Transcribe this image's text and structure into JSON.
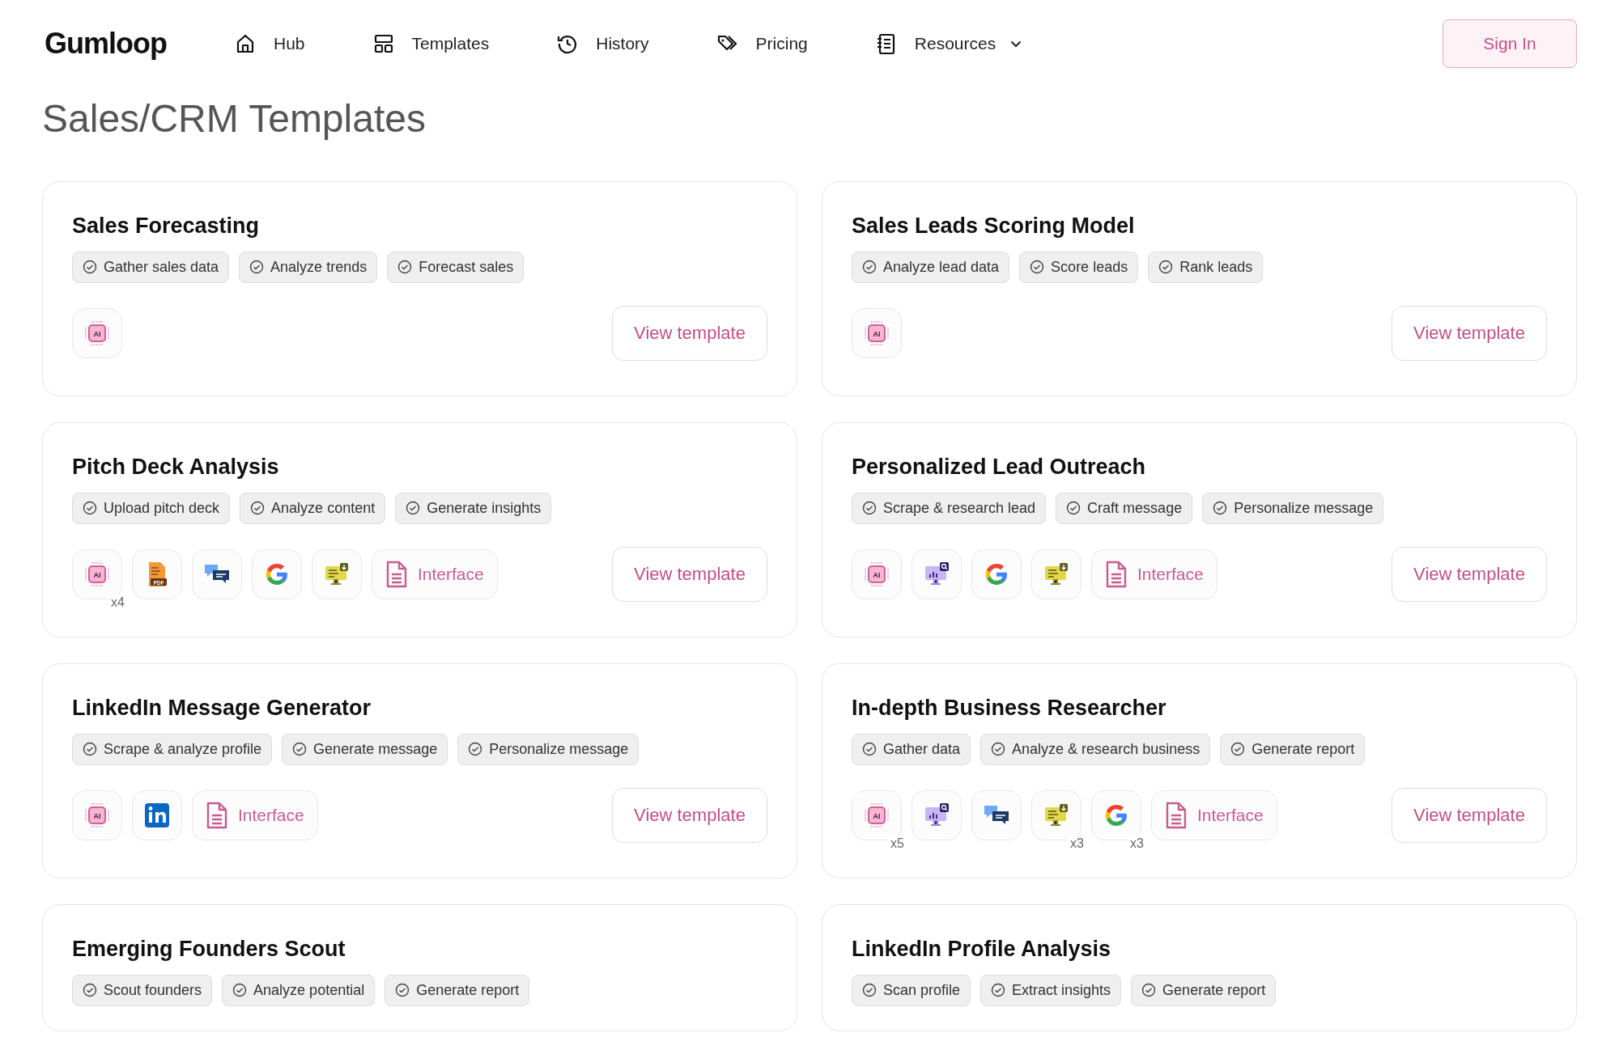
{
  "nav": {
    "logo": "Gumloop",
    "items": [
      {
        "label": "Hub",
        "dropdown": false
      },
      {
        "label": "Templates",
        "dropdown": false
      },
      {
        "label": "History",
        "dropdown": false
      },
      {
        "label": "Pricing",
        "dropdown": false
      },
      {
        "label": "Resources",
        "dropdown": true
      }
    ],
    "sign_in": "Sign In"
  },
  "page_title": "Sales/CRM Templates",
  "cards": [
    {
      "title": "Sales Forecasting",
      "steps": [
        "Gather sales data",
        "Analyze trends",
        "Forecast sales"
      ],
      "tools": [
        {
          "kind": "ai",
          "badge": "AI"
        }
      ],
      "button": "View template"
    },
    {
      "title": "Sales Leads Scoring Model",
      "steps": [
        "Analyze lead data",
        "Score leads",
        "Rank leads"
      ],
      "tools": [
        {
          "kind": "ai",
          "badge": "AI"
        }
      ],
      "button": "View template"
    },
    {
      "title": "Pitch Deck Analysis",
      "steps": [
        "Upload pitch deck",
        "Analyze content",
        "Generate insights"
      ],
      "tools": [
        {
          "kind": "ai",
          "badge": "AI",
          "count": "x4"
        },
        {
          "kind": "pdf",
          "badge": "PDF"
        },
        {
          "kind": "chat"
        },
        {
          "kind": "google"
        },
        {
          "kind": "monitor"
        },
        {
          "kind": "interface",
          "label": "Interface"
        }
      ],
      "button": "View template"
    },
    {
      "title": "Personalized Lead Outreach",
      "steps": [
        "Scrape & research lead",
        "Craft message",
        "Personalize message"
      ],
      "tools": [
        {
          "kind": "ai",
          "badge": "AI"
        },
        {
          "kind": "chart"
        },
        {
          "kind": "google"
        },
        {
          "kind": "monitor"
        },
        {
          "kind": "interface",
          "label": "Interface"
        }
      ],
      "button": "View template"
    },
    {
      "title": "LinkedIn Message Generator",
      "steps": [
        "Scrape & analyze profile",
        "Generate message",
        "Personalize message"
      ],
      "tools": [
        {
          "kind": "ai",
          "badge": "AI"
        },
        {
          "kind": "linkedin"
        },
        {
          "kind": "interface",
          "label": "Interface"
        }
      ],
      "button": "View template"
    },
    {
      "title": "In-depth Business Researcher",
      "steps": [
        "Gather data",
        "Analyze & research business",
        "Generate report"
      ],
      "tools": [
        {
          "kind": "ai",
          "badge": "AI",
          "count": "x5"
        },
        {
          "kind": "chart"
        },
        {
          "kind": "chat"
        },
        {
          "kind": "monitor",
          "count": "x3"
        },
        {
          "kind": "google",
          "count": "x3"
        },
        {
          "kind": "interface",
          "label": "Interface"
        }
      ],
      "button": "View template"
    },
    {
      "title": "Emerging Founders Scout",
      "steps": [
        "Scout founders",
        "Analyze potential",
        "Generate report"
      ]
    },
    {
      "title": "LinkedIn Profile Analysis",
      "steps": [
        "Scan profile",
        "Extract insights",
        "Generate report"
      ]
    }
  ]
}
